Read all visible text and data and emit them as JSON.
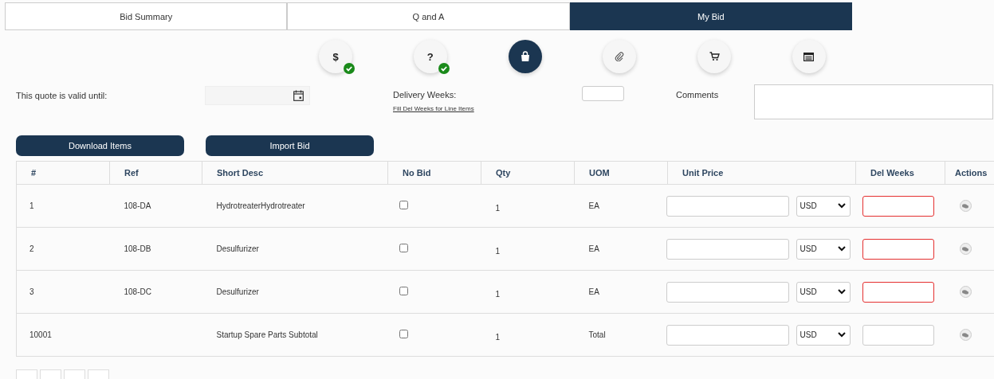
{
  "tabs": [
    {
      "label": "Bid Summary",
      "selected": false
    },
    {
      "label": "Q and A",
      "selected": false
    },
    {
      "label": "My Bid",
      "selected": true
    }
  ],
  "steps": [
    {
      "kind": "dollar",
      "glyph": "$",
      "complete": true,
      "selected": false
    },
    {
      "kind": "question",
      "glyph": "?",
      "complete": true,
      "selected": false
    },
    {
      "kind": "bag",
      "complete": false,
      "selected": true
    },
    {
      "kind": "clip",
      "complete": false,
      "selected": false
    },
    {
      "kind": "cart",
      "complete": false,
      "selected": false
    },
    {
      "kind": "list",
      "complete": false,
      "selected": false
    }
  ],
  "form": {
    "valid_until_label": "This quote is valid until:",
    "delivery_label": "Delivery Weeks:",
    "fill_link": "Fill Del Weeks for Line Items",
    "comments_label": "Comments"
  },
  "buttons": [
    "Download Items",
    "Import Bid"
  ],
  "table": {
    "columns": [
      "#",
      "Ref",
      "Short Desc",
      "No Bid",
      "Qty",
      "UOM",
      "Unit Price",
      "Del Weeks",
      "Actions"
    ],
    "rows": [
      {
        "num": "1",
        "ref": "108-DA",
        "desc": "HydrotreaterHydrotreater",
        "no_bid": false,
        "qty": "1",
        "uom": "EA",
        "currency": "USD",
        "del_weeks_invalid": true
      },
      {
        "num": "2",
        "ref": "108-DB",
        "desc": "Desulfurizer",
        "no_bid": false,
        "qty": "1",
        "uom": "EA",
        "currency": "USD",
        "del_weeks_invalid": true
      },
      {
        "num": "3",
        "ref": "108-DC",
        "desc": "Desulfurizer",
        "no_bid": false,
        "qty": "1",
        "uom": "EA",
        "currency": "USD",
        "del_weeks_invalid": true
      },
      {
        "num": "10001",
        "desc": "Startup Spare Parts Subtotal",
        "no_bid": false,
        "qty": "1",
        "uom": "Total",
        "currency": "USD",
        "del_weeks_invalid": false
      }
    ]
  }
}
